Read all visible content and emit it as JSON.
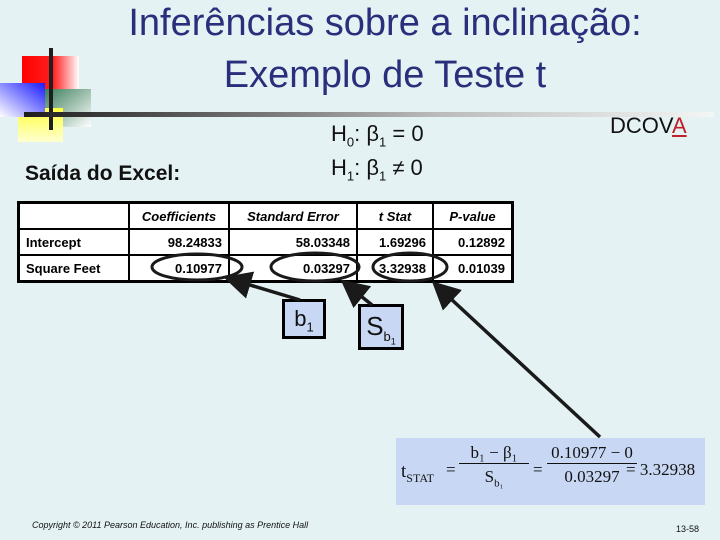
{
  "slide": {
    "title_line1": "Inferências sobre a inclinação:",
    "title_line2": "Exemplo de Teste t",
    "dcova_prefix": "DCOV",
    "dcova_highlight": "A",
    "highlight_color": "#c0202a",
    "title_color": "#2a2f7c"
  },
  "hypotheses": {
    "h0": {
      "H": "H",
      "sub": "0",
      "beta": ": β",
      "beta_sub": "1",
      "rel": " = 0"
    },
    "h1": {
      "H": "H",
      "sub": "1",
      "beta": ": β",
      "beta_sub": "1",
      "rel": " ≠ 0"
    }
  },
  "excel": {
    "label": "Saída do Excel:",
    "headers": [
      "",
      "Coefficients",
      "Standard Error",
      "t Stat",
      "P-value"
    ],
    "rows": [
      [
        "Intercept",
        "98.24833",
        "58.03348",
        "1.69296",
        "0.12892"
      ],
      [
        "Square Feet",
        "0.10977",
        "0.03297",
        "3.32938",
        "0.01039"
      ]
    ]
  },
  "callouts": {
    "b1": {
      "base": "b",
      "sub": "1"
    },
    "sb1": {
      "base": "S",
      "sub": "b",
      "subsub": "1"
    }
  },
  "formula": {
    "lhs_base": "t",
    "lhs_sub": "STAT",
    "eq": "=",
    "frac1_num": "b₁ − β₁",
    "frac1_den_base": "S",
    "frac1_den_sub": "b₁",
    "frac2_num": "0.10977 − 0",
    "frac2_den": "0.03297",
    "result": "= 3.32938"
  },
  "footer": {
    "copyright": "Copyright © 2011 Pearson Education, Inc. publishing as Prentice Hall",
    "page": "13-58"
  }
}
